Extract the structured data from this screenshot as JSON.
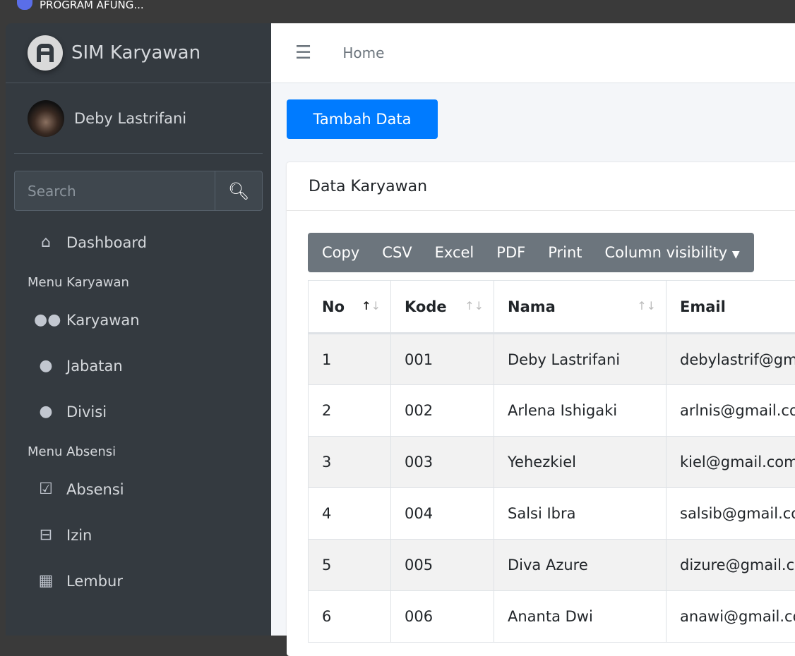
{
  "window": {
    "title": "PROGRAM AFUNG..."
  },
  "sidebar": {
    "brand": "SIM Karyawan",
    "user": "Deby Lastrifani",
    "search_placeholder": "Search",
    "items": [
      {
        "label": "Dashboard",
        "icon": "home-icon"
      },
      {
        "header": "Menu Karyawan"
      },
      {
        "label": "Karyawan",
        "icon": "users-icon"
      },
      {
        "label": "Jabatan",
        "icon": "user-tag-icon"
      },
      {
        "label": "Divisi",
        "icon": "user-shield-icon"
      },
      {
        "header": "Menu Absensi"
      },
      {
        "label": "Absensi",
        "icon": "calendar-check-icon"
      },
      {
        "label": "Izin",
        "icon": "calendar-minus-icon"
      },
      {
        "label": "Lembur",
        "icon": "calendar-icon"
      }
    ]
  },
  "header": {
    "breadcrumb": "Home"
  },
  "main": {
    "add_button": "Tambah Data",
    "card_title": "Data Karyawan",
    "export_buttons": [
      "Copy",
      "CSV",
      "Excel",
      "PDF",
      "Print",
      "Column visibility"
    ],
    "columns": [
      "No",
      "Kode",
      "Nama",
      "Email"
    ],
    "rows": [
      [
        "1",
        "001",
        "Deby Lastrifani",
        "debylastrif@gma"
      ],
      [
        "2",
        "002",
        "Arlena Ishigaki",
        "arlnis@gmail.cor"
      ],
      [
        "3",
        "003",
        "Yehezkiel",
        "kiel@gmail.com"
      ],
      [
        "4",
        "004",
        "Salsi Ibra",
        "salsib@gmail.co"
      ],
      [
        "5",
        "005",
        "Diva Azure",
        "dizure@gmail.co"
      ],
      [
        "6",
        "006",
        "Ananta Dwi",
        "anawi@gmail.co"
      ]
    ]
  },
  "colors": {
    "primary": "#007bff",
    "sidebar": "#343a40",
    "secondary": "#6c757d"
  }
}
